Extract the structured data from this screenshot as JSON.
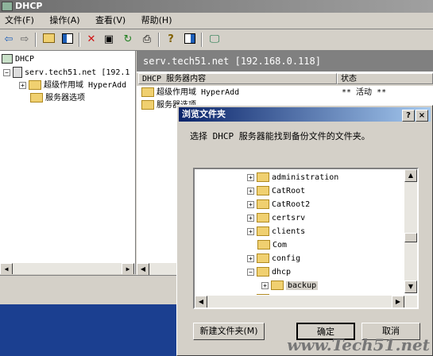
{
  "window": {
    "title": "DHCP"
  },
  "menu": {
    "items": [
      "文件(F)",
      "操作(A)",
      "查看(V)",
      "帮助(H)"
    ]
  },
  "toolbar": {
    "icons": [
      "back-arrow-icon",
      "forward-arrow-icon",
      "up-folder-icon",
      "show-hide-tree-icon",
      "delete-icon",
      "properties-icon",
      "refresh-icon",
      "export-list-icon",
      "help-icon",
      "show-hide-action-pane-icon",
      "monitor-icon"
    ]
  },
  "tree": {
    "root": "DHCP",
    "server": "serv.tech51.net [192.1",
    "scope": "超级作用域 HyperAdd",
    "options": "服务器选项"
  },
  "right": {
    "header": "serv.tech51.net [192.168.0.118]",
    "columns": [
      "DHCP 服务器内容",
      "状态"
    ],
    "rows": [
      {
        "name": "超级作用域 HyperAdd",
        "status": "** 活动 **"
      },
      {
        "name": "服务器选项",
        "status": ""
      }
    ]
  },
  "dialog": {
    "title": "浏览文件夹",
    "prompt": "选择 DHCP 服务器能找到备份文件的文件夹。",
    "folders": [
      {
        "name": "administration",
        "expand": "+"
      },
      {
        "name": "CatRoot",
        "expand": "+"
      },
      {
        "name": "CatRoot2",
        "expand": "+"
      },
      {
        "name": "certsrv",
        "expand": "+"
      },
      {
        "name": "clients",
        "expand": "+"
      },
      {
        "name": "Com",
        "expand": ""
      },
      {
        "name": "config",
        "expand": "+"
      },
      {
        "name": "dhcp",
        "expand": "-"
      },
      {
        "name": "backup",
        "expand": "+"
      },
      {
        "name": "d",
        "expand": "+"
      }
    ],
    "new_folder_button": "新建文件夹(M)",
    "ok_button": "确定",
    "cancel_button": "取消"
  },
  "watermark": "www.Tech51.net"
}
